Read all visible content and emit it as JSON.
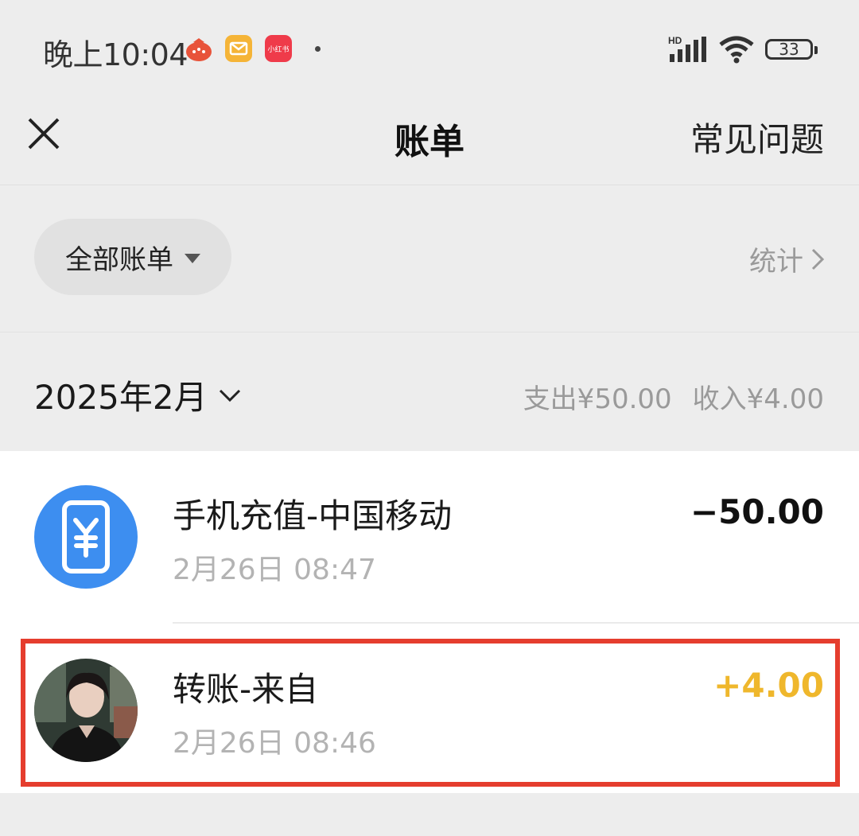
{
  "status_bar": {
    "time": "晚上10:04",
    "notif_red_label": "小红书",
    "network_label": "HD",
    "battery": "33"
  },
  "nav": {
    "title": "账单",
    "right_action": "常见问题"
  },
  "filter": {
    "label": "全部账单",
    "stats_link": "统计"
  },
  "month": {
    "label": "2025年2月",
    "expense": "支出¥50.00",
    "income": "收入¥4.00"
  },
  "transactions": [
    {
      "title": "手机充值-中国移动",
      "time": "2月26日 08:47",
      "amount": "−50.00",
      "icon": "phone-yuan-icon"
    },
    {
      "title": "转账-来自",
      "time": "2月26日 08:46",
      "amount": "+4.00",
      "icon": "avatar"
    }
  ],
  "colors": {
    "background": "#ededed",
    "income_amount": "#efb72c",
    "highlight_border": "#e53d2e",
    "phone_icon_bg": "#3d8ef0"
  }
}
